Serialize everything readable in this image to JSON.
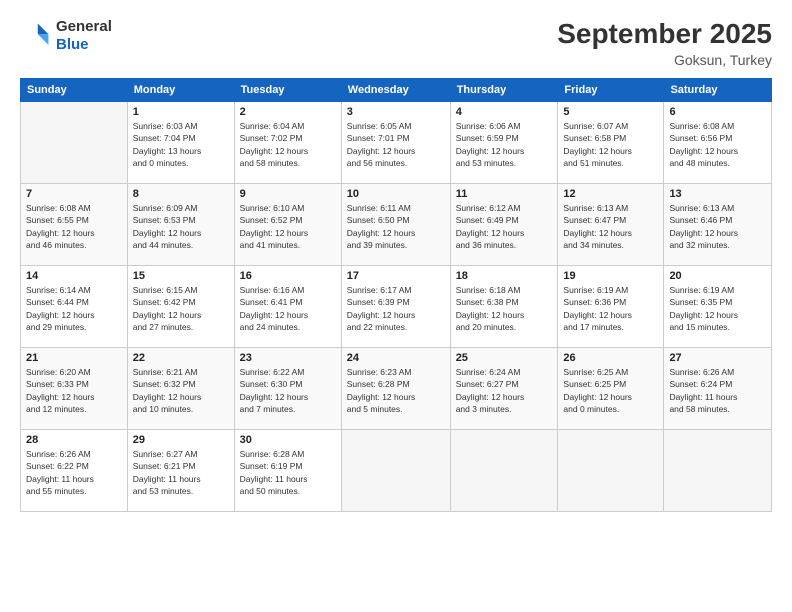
{
  "logo": {
    "line1": "General",
    "line2": "Blue"
  },
  "title": "September 2025",
  "subtitle": "Goksun, Turkey",
  "weekdays": [
    "Sunday",
    "Monday",
    "Tuesday",
    "Wednesday",
    "Thursday",
    "Friday",
    "Saturday"
  ],
  "weeks": [
    [
      {
        "day": "",
        "info": ""
      },
      {
        "day": "1",
        "info": "Sunrise: 6:03 AM\nSunset: 7:04 PM\nDaylight: 13 hours\nand 0 minutes."
      },
      {
        "day": "2",
        "info": "Sunrise: 6:04 AM\nSunset: 7:02 PM\nDaylight: 12 hours\nand 58 minutes."
      },
      {
        "day": "3",
        "info": "Sunrise: 6:05 AM\nSunset: 7:01 PM\nDaylight: 12 hours\nand 56 minutes."
      },
      {
        "day": "4",
        "info": "Sunrise: 6:06 AM\nSunset: 6:59 PM\nDaylight: 12 hours\nand 53 minutes."
      },
      {
        "day": "5",
        "info": "Sunrise: 6:07 AM\nSunset: 6:58 PM\nDaylight: 12 hours\nand 51 minutes."
      },
      {
        "day": "6",
        "info": "Sunrise: 6:08 AM\nSunset: 6:56 PM\nDaylight: 12 hours\nand 48 minutes."
      }
    ],
    [
      {
        "day": "7",
        "info": "Sunrise: 6:08 AM\nSunset: 6:55 PM\nDaylight: 12 hours\nand 46 minutes."
      },
      {
        "day": "8",
        "info": "Sunrise: 6:09 AM\nSunset: 6:53 PM\nDaylight: 12 hours\nand 44 minutes."
      },
      {
        "day": "9",
        "info": "Sunrise: 6:10 AM\nSunset: 6:52 PM\nDaylight: 12 hours\nand 41 minutes."
      },
      {
        "day": "10",
        "info": "Sunrise: 6:11 AM\nSunset: 6:50 PM\nDaylight: 12 hours\nand 39 minutes."
      },
      {
        "day": "11",
        "info": "Sunrise: 6:12 AM\nSunset: 6:49 PM\nDaylight: 12 hours\nand 36 minutes."
      },
      {
        "day": "12",
        "info": "Sunrise: 6:13 AM\nSunset: 6:47 PM\nDaylight: 12 hours\nand 34 minutes."
      },
      {
        "day": "13",
        "info": "Sunrise: 6:13 AM\nSunset: 6:46 PM\nDaylight: 12 hours\nand 32 minutes."
      }
    ],
    [
      {
        "day": "14",
        "info": "Sunrise: 6:14 AM\nSunset: 6:44 PM\nDaylight: 12 hours\nand 29 minutes."
      },
      {
        "day": "15",
        "info": "Sunrise: 6:15 AM\nSunset: 6:42 PM\nDaylight: 12 hours\nand 27 minutes."
      },
      {
        "day": "16",
        "info": "Sunrise: 6:16 AM\nSunset: 6:41 PM\nDaylight: 12 hours\nand 24 minutes."
      },
      {
        "day": "17",
        "info": "Sunrise: 6:17 AM\nSunset: 6:39 PM\nDaylight: 12 hours\nand 22 minutes."
      },
      {
        "day": "18",
        "info": "Sunrise: 6:18 AM\nSunset: 6:38 PM\nDaylight: 12 hours\nand 20 minutes."
      },
      {
        "day": "19",
        "info": "Sunrise: 6:19 AM\nSunset: 6:36 PM\nDaylight: 12 hours\nand 17 minutes."
      },
      {
        "day": "20",
        "info": "Sunrise: 6:19 AM\nSunset: 6:35 PM\nDaylight: 12 hours\nand 15 minutes."
      }
    ],
    [
      {
        "day": "21",
        "info": "Sunrise: 6:20 AM\nSunset: 6:33 PM\nDaylight: 12 hours\nand 12 minutes."
      },
      {
        "day": "22",
        "info": "Sunrise: 6:21 AM\nSunset: 6:32 PM\nDaylight: 12 hours\nand 10 minutes."
      },
      {
        "day": "23",
        "info": "Sunrise: 6:22 AM\nSunset: 6:30 PM\nDaylight: 12 hours\nand 7 minutes."
      },
      {
        "day": "24",
        "info": "Sunrise: 6:23 AM\nSunset: 6:28 PM\nDaylight: 12 hours\nand 5 minutes."
      },
      {
        "day": "25",
        "info": "Sunrise: 6:24 AM\nSunset: 6:27 PM\nDaylight: 12 hours\nand 3 minutes."
      },
      {
        "day": "26",
        "info": "Sunrise: 6:25 AM\nSunset: 6:25 PM\nDaylight: 12 hours\nand 0 minutes."
      },
      {
        "day": "27",
        "info": "Sunrise: 6:26 AM\nSunset: 6:24 PM\nDaylight: 11 hours\nand 58 minutes."
      }
    ],
    [
      {
        "day": "28",
        "info": "Sunrise: 6:26 AM\nSunset: 6:22 PM\nDaylight: 11 hours\nand 55 minutes."
      },
      {
        "day": "29",
        "info": "Sunrise: 6:27 AM\nSunset: 6:21 PM\nDaylight: 11 hours\nand 53 minutes."
      },
      {
        "day": "30",
        "info": "Sunrise: 6:28 AM\nSunset: 6:19 PM\nDaylight: 11 hours\nand 50 minutes."
      },
      {
        "day": "",
        "info": ""
      },
      {
        "day": "",
        "info": ""
      },
      {
        "day": "",
        "info": ""
      },
      {
        "day": "",
        "info": ""
      }
    ]
  ]
}
